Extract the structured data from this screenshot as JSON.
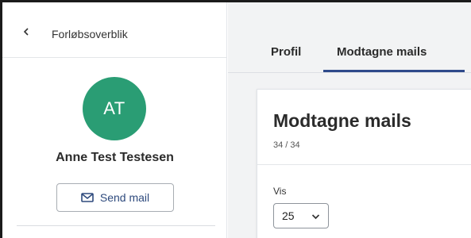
{
  "sidebar": {
    "back_label": "Forløbsoverblik",
    "avatar_initials": "AT",
    "user_name": "Anne Test Testesen",
    "send_mail_label": "Send mail",
    "icons": {
      "back": "chevron-left-icon",
      "mail": "envelope-icon"
    }
  },
  "tabs": [
    {
      "label": "Profil",
      "active": false
    },
    {
      "label": "Modtagne mails",
      "active": true
    }
  ],
  "card": {
    "title": "Modtagne mails",
    "count": "34 / 34",
    "vis_label": "Vis",
    "vis_selected": "25"
  },
  "colors": {
    "avatar": "#2a9d74",
    "accent": "#2e4a8a",
    "button_text": "#2e4a7d"
  }
}
